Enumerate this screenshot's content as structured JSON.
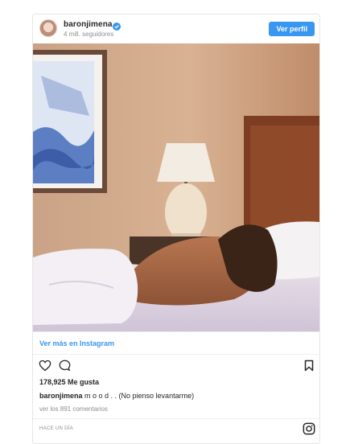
{
  "header": {
    "username": "baronjimena",
    "followers": "4 mill. seguidores",
    "follow_label": "Ver perfil"
  },
  "photo": {
    "description_icon": "photo"
  },
  "footer": {
    "view_more": "Ver más en Instagram",
    "likes": "178,925 Me gusta",
    "caption_user": "baronjimena",
    "caption_text": " m o o d . . (No pienso levantarme)",
    "comments": "ver los 891 comentarios",
    "time": "HACE UN DÍA"
  },
  "icons": {
    "like": "heart-icon",
    "comment": "comment-icon",
    "save": "bookmark-icon",
    "instagram": "instagram-logo-icon",
    "verified": "verified-badge-icon"
  },
  "colors": {
    "accent": "#3897f0",
    "text": "#262626",
    "muted": "#8e8e8e"
  }
}
